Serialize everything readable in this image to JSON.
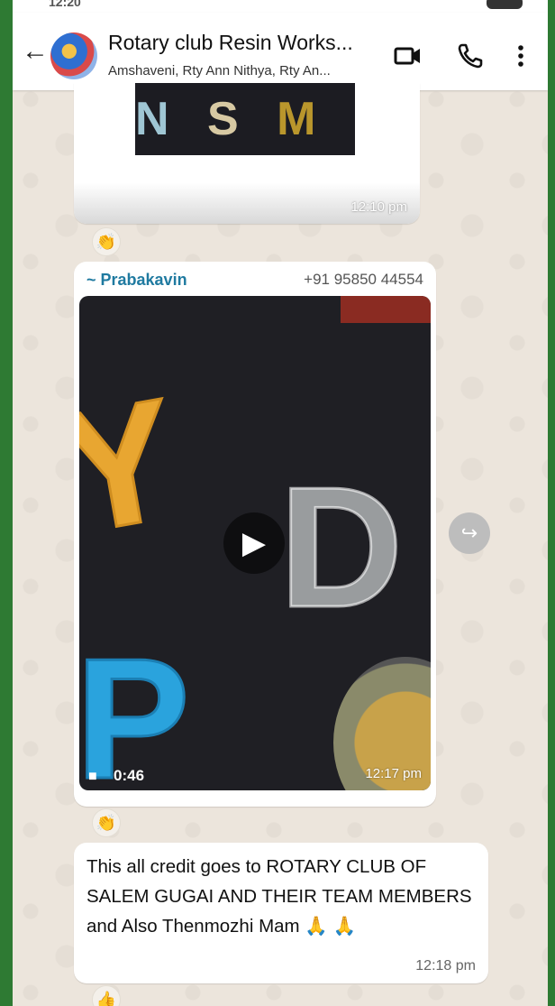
{
  "status": {
    "time": "12:20"
  },
  "header": {
    "back_icon": "arrow-left-icon",
    "title": "Rotary club Resin Works...",
    "subtitle": "Amshaveni, Rty Ann Nithya, Rty An...",
    "actions": [
      "video-call-icon",
      "voice-call-icon",
      "more-vert-icon"
    ]
  },
  "messages": [
    {
      "type": "image",
      "image_letters": [
        "N",
        "S",
        "M"
      ],
      "time": "12:10 pm",
      "reaction": "👏"
    },
    {
      "type": "video",
      "sender": "~ Prabakavin",
      "phone": "+91 95850 44554",
      "video_letters": [
        "Y",
        "D",
        "P"
      ],
      "duration": "0:46",
      "time": "12:17 pm",
      "reaction": "👏"
    },
    {
      "type": "text",
      "text": "This all credit goes to ROTARY CLUB OF SALEM GUGAI AND THEIR TEAM MEMBERS and Also Thenmozhi Mam 🙏 🙏",
      "time": "12:18 pm",
      "reaction": "👍"
    }
  ],
  "colors": {
    "frame": "#2e7a33",
    "chat_background": "#ece5dc",
    "sender_name": "#1f7aa0"
  }
}
